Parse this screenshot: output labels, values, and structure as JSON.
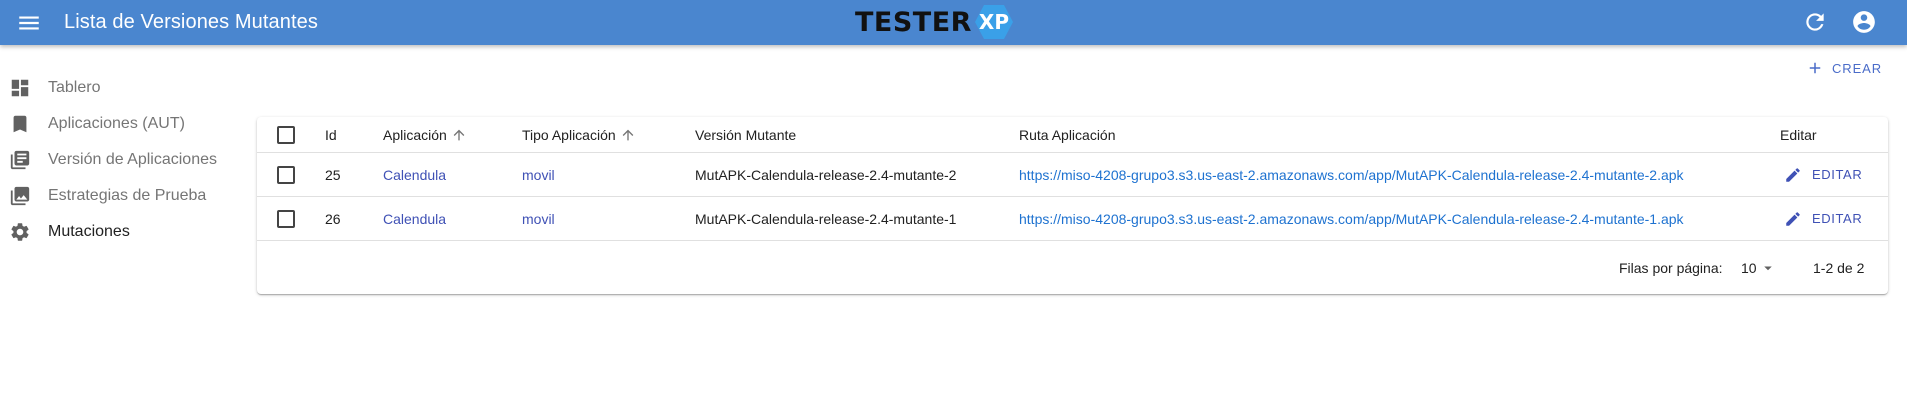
{
  "appbar": {
    "title": "Lista de Versiones Mutantes",
    "logo_text": "TESTER",
    "logo_badge": "XP",
    "logo_badge_color": "#3aa0e8",
    "color": "#4a86cf"
  },
  "sidebar": {
    "items": [
      {
        "label": "Tablero",
        "icon": "dashboard-icon"
      },
      {
        "label": "Aplicaciones (AUT)",
        "icon": "bookmark-icon"
      },
      {
        "label": "Versión de Aplicaciones",
        "icon": "library-books-icon"
      },
      {
        "label": "Estrategias de Prueba",
        "icon": "photo-library-icon"
      },
      {
        "label": "Mutaciones",
        "icon": "gear-icon",
        "active": true
      }
    ]
  },
  "toolbar": {
    "create_label": "CREAR"
  },
  "table": {
    "columns": [
      "Id",
      "Aplicación",
      "Tipo Aplicación",
      "Versión Mutante",
      "Ruta Aplicación",
      "Editar"
    ],
    "rows": [
      {
        "id": "25",
        "aplicacion": "Calendula",
        "tipo": "movil",
        "version": "MutAPK-Calendula-release-2.4-mutante-2",
        "ruta": "https://miso-4208-grupo3.s3.us-east-2.amazonaws.com/app/MutAPK-Calendula-release-2.4-mutante-2.apk",
        "edit_label": "EDITAR"
      },
      {
        "id": "26",
        "aplicacion": "Calendula",
        "tipo": "movil",
        "version": "MutAPK-Calendula-release-2.4-mutante-1",
        "ruta": "https://miso-4208-grupo3.s3.us-east-2.amazonaws.com/app/MutAPK-Calendula-release-2.4-mutante-1.apk",
        "edit_label": "EDITAR"
      }
    ]
  },
  "pagination": {
    "rows_per_page_label": "Filas por página:",
    "rows_per_page_value": "10",
    "range": "1-2 de 2"
  }
}
